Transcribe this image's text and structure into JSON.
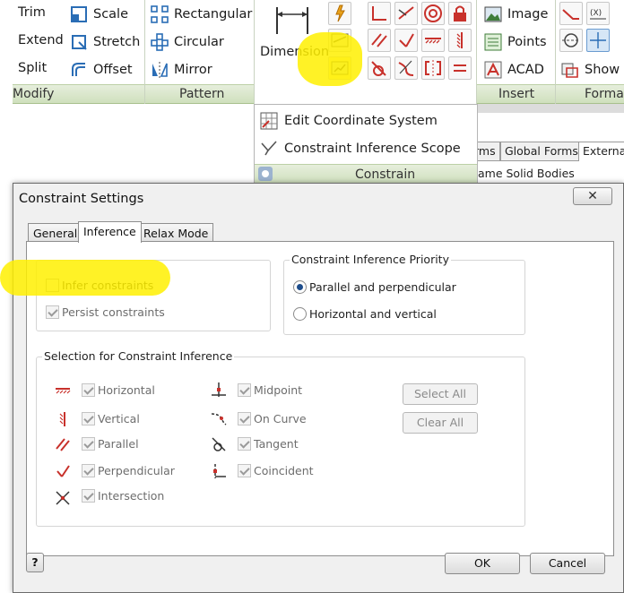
{
  "ribbon": {
    "modify": {
      "items": [
        "Trim",
        "Extend",
        "Split"
      ],
      "items2": [
        "Scale",
        "Stretch",
        "Offset"
      ],
      "label": "Modify"
    },
    "pattern": {
      "items": [
        "Rectangular",
        "Circular",
        "Mirror"
      ],
      "label": "Pattern"
    },
    "dimension_label": "Dimension",
    "insert": {
      "items": [
        "Image",
        "Points",
        "ACAD"
      ],
      "label": "Insert"
    },
    "format": {
      "show_label": "Show F",
      "label": "Forma"
    }
  },
  "dropdown": {
    "items": [
      "Edit Coordinate System",
      "Constraint Inference Scope"
    ],
    "bar_label": "Constrain"
  },
  "background": {
    "tabs": [
      "rms",
      "Global Forms",
      "Externa"
    ],
    "text": "ame Solid Bodies"
  },
  "dialog": {
    "title": "Constraint Settings",
    "close": "✕",
    "tabs": [
      "General",
      "Inference",
      "Relax Mode"
    ],
    "infer_group": {
      "infer": "Infer constraints",
      "persist": "Persist constraints"
    },
    "priority": {
      "title": "Constraint Inference Priority",
      "options": [
        "Parallel and perpendicular",
        "Horizontal and vertical"
      ]
    },
    "selection": {
      "title": "Selection for Constraint Inference",
      "left": [
        "Horizontal",
        "Vertical",
        "Parallel",
        "Perpendicular",
        "Intersection"
      ],
      "right": [
        "Midpoint",
        "On Curve",
        "Tangent",
        "Coincident"
      ],
      "select_all": "Select All",
      "clear_all": "Clear All"
    },
    "help": "?",
    "ok": "OK",
    "cancel": "Cancel"
  },
  "colors": {
    "highlight": "#fff000",
    "constraint_red": "#c8312b",
    "ribbon_bar": "#d6e5c6"
  }
}
